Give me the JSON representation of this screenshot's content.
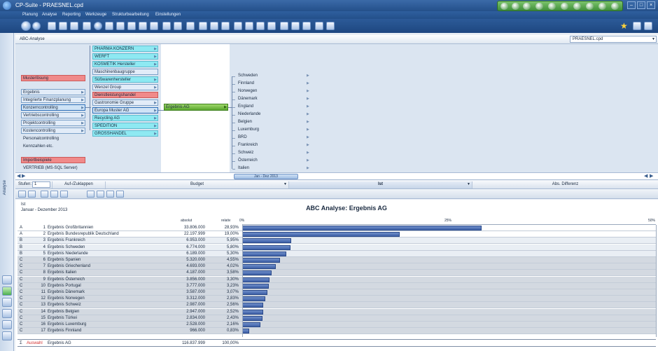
{
  "window": {
    "title": "CP-Suite - PRAESNEL.cpd"
  },
  "menu": [
    "Planung",
    "Analyse",
    "Reporting",
    "Werkzeuge",
    "Strukturbearbeitung",
    "Einstellungen"
  ],
  "tab": {
    "label": "ABC-Analyse",
    "file": "PRAESNEL.cpd"
  },
  "sidebar": {
    "vertical_label": "Analyse"
  },
  "diagram": {
    "level1": [
      {
        "label": "Musterlösung",
        "style": "red"
      },
      {
        "label": "Ergebnis",
        "style": "normal"
      },
      {
        "label": "Integrierte Finanzplanung",
        "style": "normal"
      },
      {
        "label": "Konzerncontrolling",
        "style": "sel"
      },
      {
        "label": "Vertriebscontrolling",
        "style": "normal"
      },
      {
        "label": "Projektcontrolling",
        "style": "normal"
      },
      {
        "label": "Kostencontrolling",
        "style": "normal"
      },
      {
        "label": "Personalcontrolling",
        "style": "plain"
      },
      {
        "label": "Kennzahlen etc.",
        "style": "plain"
      },
      {
        "label": "Importbeispiele",
        "style": "red"
      },
      {
        "label": "VERTRIEB (MS-SQL Server)",
        "style": "plain"
      }
    ],
    "level2": [
      {
        "label": "PHARMA KONZERN",
        "style": "cyan"
      },
      {
        "label": "WERFT",
        "style": "cyan"
      },
      {
        "label": "KOSMETIK Hersteller",
        "style": "cyan"
      },
      {
        "label": "Maschinenbaugruppe",
        "style": "normal"
      },
      {
        "label": "Süßwarenhersteller",
        "style": "cyan"
      },
      {
        "label": "Wenzel Group",
        "style": "normal"
      },
      {
        "label": "Dienstleistungshandel",
        "style": "red"
      },
      {
        "label": "Gastronomie Gruppe",
        "style": "normal"
      },
      {
        "label": "Europa Muster AG",
        "style": "sel"
      },
      {
        "label": "Recycling AG",
        "style": "cyan"
      },
      {
        "label": "SPEDITION",
        "style": "cyan"
      },
      {
        "label": "GROSSHANDEL",
        "style": "cyan"
      }
    ],
    "selected_node": "Ergebnis AG",
    "countries": [
      "Schweden",
      "Finnland",
      "Norwegen",
      "Dänemark",
      "England",
      "Niederlande",
      "Belgien",
      "Luxemburg",
      "BRD",
      "Frankreich",
      "Schweiz",
      "Österreich",
      "Italien"
    ],
    "timeline_label": "Jan - Dez 2013"
  },
  "columns": {
    "stufen_label": "Stufen:",
    "stufen_value": "1",
    "headers": [
      "Auf-/Zuklappen",
      "Budget",
      "Ist",
      "Abs. Differenz"
    ]
  },
  "report": {
    "ist_label": "Ist",
    "period": "Januar - Dezember 2013",
    "title": "ABC Analyse: Ergebnis AG",
    "col_absolut": "absolut",
    "col_relativ": "relativ",
    "axis_labels": [
      "0%",
      "25%",
      "50%"
    ],
    "rows": [
      {
        "cls": "A",
        "rank": "1",
        "name": "Ergebnis Großbritannien",
        "abs": "33.806.000",
        "rel": "28,93%",
        "pct": 28.93
      },
      {
        "cls": "A",
        "rank": "2",
        "name": "Ergebnis Bundesrepublik Deutschland",
        "abs": "22.197.999",
        "rel": "19,00%",
        "pct": 19.0
      },
      {
        "cls": "B",
        "rank": "3",
        "name": "Ergebnis Frankreich",
        "abs": "6.953.000",
        "rel": "5,95%",
        "pct": 5.95
      },
      {
        "cls": "B",
        "rank": "4",
        "name": "Ergebnis Schweden",
        "abs": "6.774.000",
        "rel": "5,80%",
        "pct": 5.8
      },
      {
        "cls": "B",
        "rank": "5",
        "name": "Ergebnis Niederlande",
        "abs": "6.189.000",
        "rel": "5,30%",
        "pct": 5.3
      },
      {
        "cls": "C",
        "rank": "6",
        "name": "Ergebnis Spanien",
        "abs": "5.320.000",
        "rel": "4,55%",
        "pct": 4.55
      },
      {
        "cls": "C",
        "rank": "7",
        "name": "Ergebnis Griechenland",
        "abs": "4.693.000",
        "rel": "4,02%",
        "pct": 4.02
      },
      {
        "cls": "C",
        "rank": "8",
        "name": "Ergebnis Italien",
        "abs": "4.187.000",
        "rel": "3,58%",
        "pct": 3.58
      },
      {
        "cls": "C",
        "rank": "9",
        "name": "Ergebnis Österreich",
        "abs": "3.856.000",
        "rel": "3,30%",
        "pct": 3.3
      },
      {
        "cls": "C",
        "rank": "10",
        "name": "Ergebnis Portugal",
        "abs": "3.777.000",
        "rel": "3,23%",
        "pct": 3.23
      },
      {
        "cls": "C",
        "rank": "11",
        "name": "Ergebnis Dänemark",
        "abs": "3.587.000",
        "rel": "3,07%",
        "pct": 3.07
      },
      {
        "cls": "C",
        "rank": "12",
        "name": "Ergebnis Norwegen",
        "abs": "3.312.000",
        "rel": "2,83%",
        "pct": 2.83
      },
      {
        "cls": "C",
        "rank": "13",
        "name": "Ergebnis Schweiz",
        "abs": "2.987.000",
        "rel": "2,56%",
        "pct": 2.56
      },
      {
        "cls": "C",
        "rank": "14",
        "name": "Ergebnis Belgien",
        "abs": "2.947.000",
        "rel": "2,52%",
        "pct": 2.52
      },
      {
        "cls": "C",
        "rank": "15",
        "name": "Ergebnis Türkei",
        "abs": "2.834.000",
        "rel": "2,43%",
        "pct": 2.43
      },
      {
        "cls": "C",
        "rank": "16",
        "name": "Ergebnis Luxemburg",
        "abs": "2.528.000",
        "rel": "2,16%",
        "pct": 2.16
      },
      {
        "cls": "C",
        "rank": "17",
        "name": "Ergebnis Finnland",
        "abs": "966.000",
        "rel": "0,83%",
        "pct": 0.83
      }
    ],
    "total": {
      "sigma": "Σ",
      "auswahl": "Auswahl",
      "name": "Ergebnis AG",
      "abs": "116.837.999",
      "rel": "100,00%"
    }
  },
  "colors": {
    "accent": "#24508a",
    "bar": "#3d5fa6",
    "cyan_node": "#8ee9f2",
    "red_node": "#f08a8a",
    "green_node": "#5aa72e",
    "auswahl": "#d32f2f"
  }
}
